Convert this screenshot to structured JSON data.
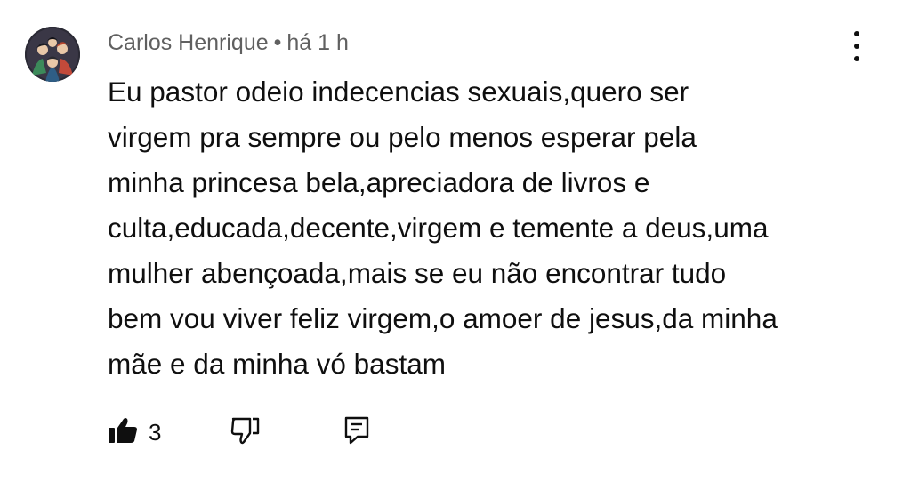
{
  "comment": {
    "author": "Carlos Henrique",
    "separator": "•",
    "time": "há 1 h",
    "body_lines": [
      "Eu pastor odeio indecencias sexuais,quero ser",
      "virgem pra sempre ou pelo menos esperar pela",
      "minha princesa bela,apreciadora de livros e",
      "culta,educada,decente,virgem e temente a deus,uma",
      "mulher abençoada,mais se eu não encontrar tudo",
      "bem vou viver feliz virgem,o amoer de jesus,da minha",
      "mãe e da minha vó bastam"
    ],
    "like_count": "3"
  },
  "icons": {
    "avatar": "avatar-image",
    "menu": "more-vert-icon",
    "like": "thumb-up-filled-icon",
    "dislike": "thumb-down-outline-icon",
    "reply": "comment-reply-icon"
  }
}
